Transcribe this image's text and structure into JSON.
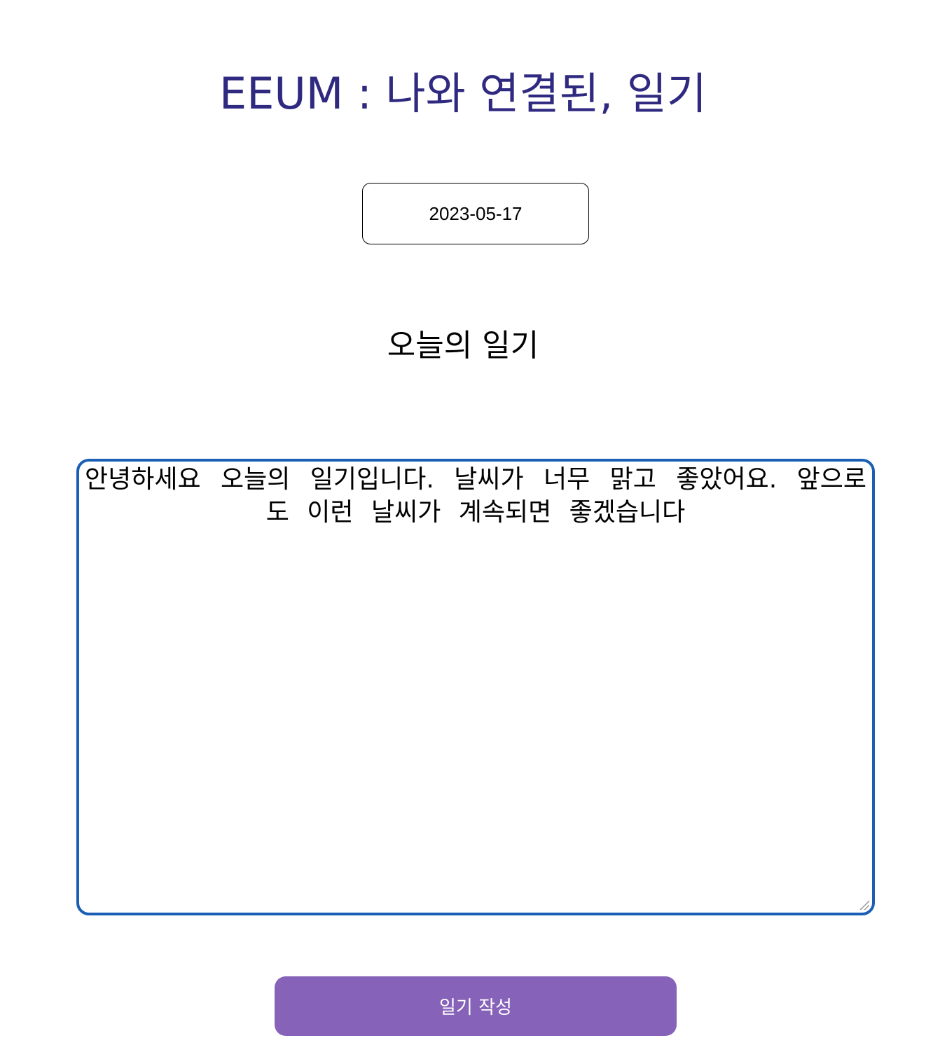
{
  "header": {
    "title": "EEUM : 나와 연결된, 일기"
  },
  "date_input": {
    "value": "2023-05-17"
  },
  "diary": {
    "heading": "오늘의 일기",
    "content": "안녕하세요 오늘의 일기입니다. 날씨가 너무 맑고 좋았어요. 앞으로도 이런 날씨가 계속되면 좋겠습니다"
  },
  "actions": {
    "submit_label": "일기 작성"
  },
  "colors": {
    "title": "#2f2a80",
    "textarea_focus_border": "#1a5fb4",
    "button_background": "#8662b8",
    "button_text": "#ffffff"
  }
}
